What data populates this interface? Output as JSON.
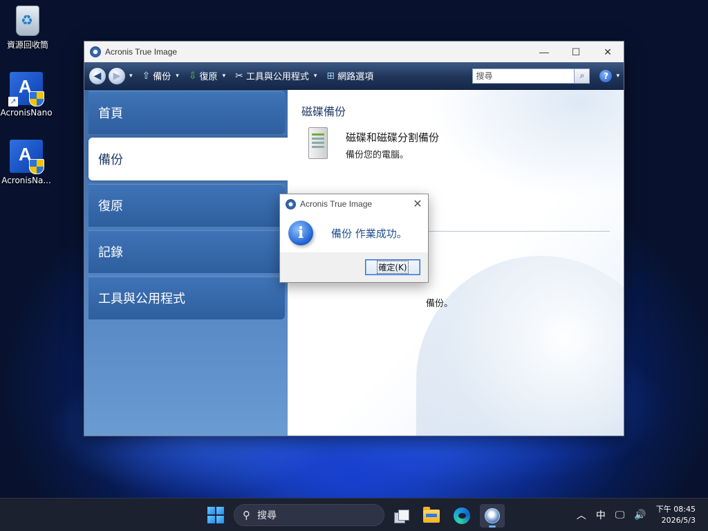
{
  "desktop": {
    "icons": [
      {
        "label": "資源回收筒",
        "icon": "recycle-bin-icon"
      },
      {
        "label": "AcronisNano",
        "icon": "acronis-shortcut-icon"
      },
      {
        "label": "AcronisNa...",
        "icon": "acronis-app-icon"
      }
    ]
  },
  "window": {
    "title": "Acronis True Image",
    "controls": {
      "minimize": "—",
      "maximize": "☐",
      "close": "✕"
    },
    "toolbar": {
      "back": "◀",
      "forward": "▶",
      "items": [
        {
          "label": "備份",
          "icon": "backup-icon"
        },
        {
          "label": "復原",
          "icon": "recovery-icon"
        },
        {
          "label": "工具與公用程式",
          "icon": "tools-icon"
        },
        {
          "label": "網路選項",
          "icon": "network-icon"
        }
      ],
      "search": {
        "placeholder": "搜尋",
        "value": "搜尋"
      },
      "help": "?"
    },
    "sidebar": {
      "items": [
        {
          "label": "首頁",
          "active": false
        },
        {
          "label": "備份",
          "active": true
        },
        {
          "label": "復原",
          "active": false
        },
        {
          "label": "記錄",
          "active": false
        },
        {
          "label": "工具與公用程式",
          "active": false
        }
      ]
    },
    "content": {
      "section_title": "磁碟備份",
      "task": {
        "title": "磁碟和磁碟分割備份",
        "description": "備份您的電腦。"
      },
      "partial_text": "備份。"
    }
  },
  "dialog": {
    "title": "Acronis True Image",
    "close": "✕",
    "message": "備份 作業成功。",
    "ok_label": "確定(K)"
  },
  "taskbar": {
    "search_label": "搜尋",
    "tray": {
      "chevron": "︿",
      "ime": "中",
      "clock_time": "下午 08:45",
      "clock_date": "2026/5/3"
    }
  }
}
